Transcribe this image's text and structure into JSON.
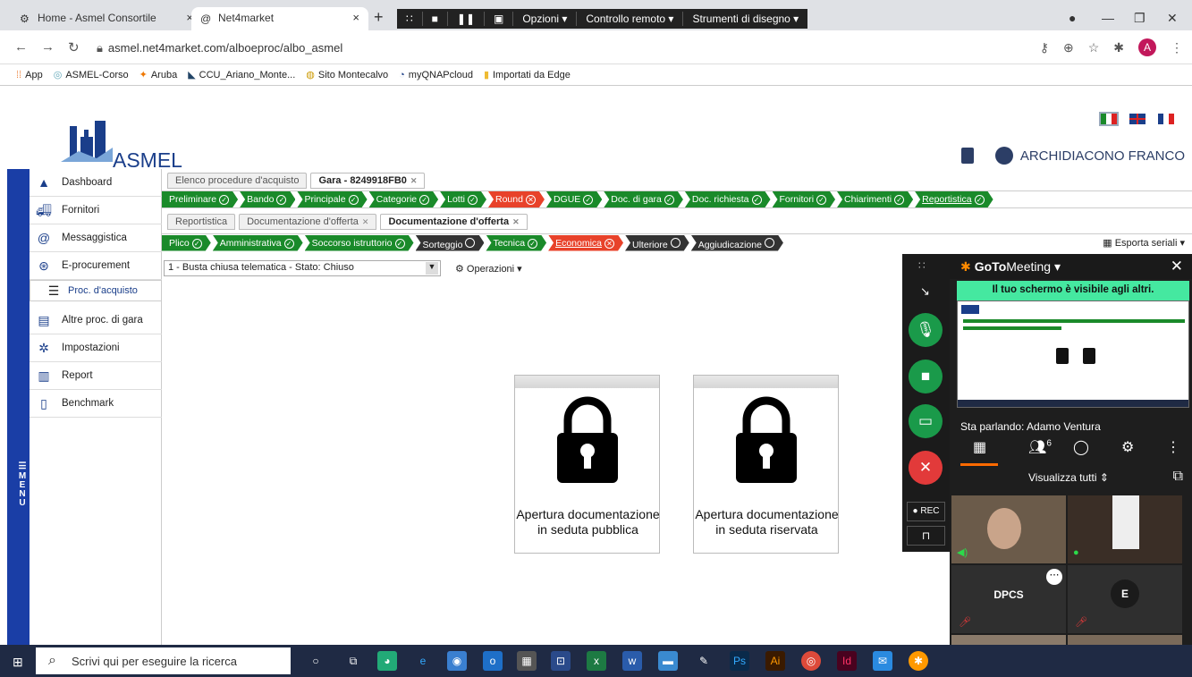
{
  "browser": {
    "tabs": [
      {
        "title": "Home - Asmel Consortile",
        "icon": "gear-icon"
      },
      {
        "title": "Net4market",
        "icon": "at-icon"
      }
    ],
    "new_tab": "+",
    "url": "asmel.net4market.com/alboeproc/albo_asmel",
    "bookmarks": [
      "App",
      "ASMEL-Corso",
      "Aruba",
      "CCU_Ariano_Monte...",
      "Sito Montecalvo",
      "myQNAPcloud",
      "Importati da Edge"
    ],
    "profile_initial": "A"
  },
  "remote_toolbar": {
    "options": "Opzioni ▾",
    "remote": "Controllo remoto ▾",
    "draw": "Strumenti di disegno ▾"
  },
  "header": {
    "logo_text": "ASMEL",
    "user_name": "ARCHIDIACONO FRANCO"
  },
  "leftbar": {
    "label": "MENU"
  },
  "sidebar": {
    "items": [
      {
        "label": "Dashboard",
        "icon": "home-icon"
      },
      {
        "label": "Fornitori",
        "icon": "truck-icon"
      },
      {
        "label": "Messaggistica",
        "icon": "at-icon"
      },
      {
        "label": "E-procurement",
        "icon": "cart-icon"
      },
      {
        "label": "Proc. d'acquisto",
        "icon": "list-icon"
      },
      {
        "label": "Altre proc. di gara",
        "icon": "stack-icon"
      },
      {
        "label": "Impostazioni",
        "icon": "gear-icon"
      },
      {
        "label": "Report",
        "icon": "chart-icon"
      },
      {
        "label": "Benchmark",
        "icon": "document-icon"
      }
    ]
  },
  "tabs_level1": [
    {
      "label": "Elenco procedure d'acquisto",
      "active": false
    },
    {
      "label": "Gara - 8249918FB0",
      "active": true
    }
  ],
  "steps_level1": [
    {
      "label": "Preliminare",
      "status": "ok"
    },
    {
      "label": "Bando",
      "status": "ok"
    },
    {
      "label": "Principale",
      "status": "ok"
    },
    {
      "label": "Categorie",
      "status": "ok"
    },
    {
      "label": "Lotti",
      "status": "ok"
    },
    {
      "label": "Round",
      "status": "error"
    },
    {
      "label": "DGUE",
      "status": "ok"
    },
    {
      "label": "Doc. di gara",
      "status": "ok"
    },
    {
      "label": "Doc. richiesta",
      "status": "ok"
    },
    {
      "label": "Fornitori",
      "status": "ok"
    },
    {
      "label": "Chiarimenti",
      "status": "ok"
    },
    {
      "label": "Reportistica",
      "status": "ok"
    }
  ],
  "tabs_level2": [
    {
      "label": "Reportistica",
      "active": false
    },
    {
      "label": "Documentazione d'offerta",
      "active": false
    },
    {
      "label": "Documentazione d'offerta",
      "active": true
    }
  ],
  "steps_level2": [
    {
      "label": "Plico",
      "status": "ok"
    },
    {
      "label": "Amministrativa",
      "status": "ok"
    },
    {
      "label": "Soccorso istruttorio",
      "status": "ok"
    },
    {
      "label": "Sorteggio",
      "status": "pending"
    },
    {
      "label": "Tecnica",
      "status": "ok"
    },
    {
      "label": "Economica",
      "status": "error"
    },
    {
      "label": "Ulteriore",
      "status": "pending"
    },
    {
      "label": "Aggiudicazione",
      "status": "pending"
    }
  ],
  "export_label": "Esporta seriali ▾",
  "select": {
    "value": "1 - Busta chiusa telematica - Stato: Chiuso"
  },
  "operations_label": "Operazioni ▾",
  "cards": [
    {
      "text": "Apertura documentazione in seduta pubblica"
    },
    {
      "text": "Apertura documentazione in seduta riservata"
    }
  ],
  "gotomeeting": {
    "brand_go": "GoTo",
    "brand_meeting": "Meeting ▾",
    "share_banner": "Il tuo schermo è visibile agli altri.",
    "speaking": "Sta parlando: Adamo Ventura",
    "participants_count": "6",
    "view_all": "Visualizza tutti",
    "rec_label": "● REC",
    "tiles": [
      {
        "name": "DPCS"
      },
      {
        "name": "E"
      }
    ]
  },
  "taskbar": {
    "search_placeholder": "Scrivi qui per eseguire la ricerca"
  }
}
